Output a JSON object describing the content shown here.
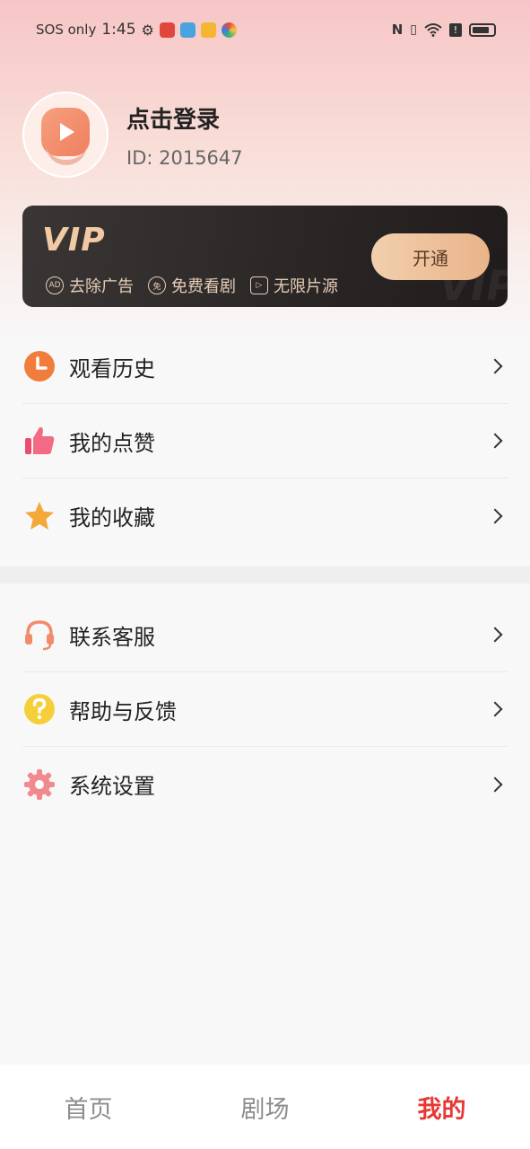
{
  "status_bar": {
    "carrier": "SOS only",
    "time": "1:45",
    "app_icons": [
      "settings-icon",
      "app-red-icon",
      "app-blue-icon",
      "app-yellow-icon",
      "app-color-icon"
    ],
    "right_icons": [
      "nfc-icon",
      "vibrate-icon",
      "wifi-icon",
      "alert-icon",
      "battery-icon"
    ]
  },
  "profile": {
    "title": "点击登录",
    "user_id": "ID: 2015647"
  },
  "vip": {
    "logo": "VIP",
    "watermark": "VIP",
    "perks": [
      "去除广告",
      "免费看剧",
      "无限片源"
    ],
    "open_label": "开通"
  },
  "menu_group_1": [
    {
      "label": "观看历史",
      "icon": "clock-icon",
      "color": "#f07d3c"
    },
    {
      "label": "我的点赞",
      "icon": "thumbs-up-icon",
      "color": "#ee4c6b"
    },
    {
      "label": "我的收藏",
      "icon": "star-icon",
      "color": "#f3a93a"
    }
  ],
  "menu_group_2": [
    {
      "label": "联系客服",
      "icon": "headset-icon",
      "color": "#f28b6c"
    },
    {
      "label": "帮助与反馈",
      "icon": "question-icon",
      "color": "#f5cf3a"
    },
    {
      "label": "系统设置",
      "icon": "gear-icon",
      "color": "#f08a8f"
    }
  ],
  "tabs": [
    {
      "label": "首页",
      "active": false
    },
    {
      "label": "剧场",
      "active": false
    },
    {
      "label": "我的",
      "active": true
    }
  ],
  "colors": {
    "accent": "#e53935",
    "vip_gold": "#f1c9a3",
    "vip_bg": "#2a2625"
  }
}
